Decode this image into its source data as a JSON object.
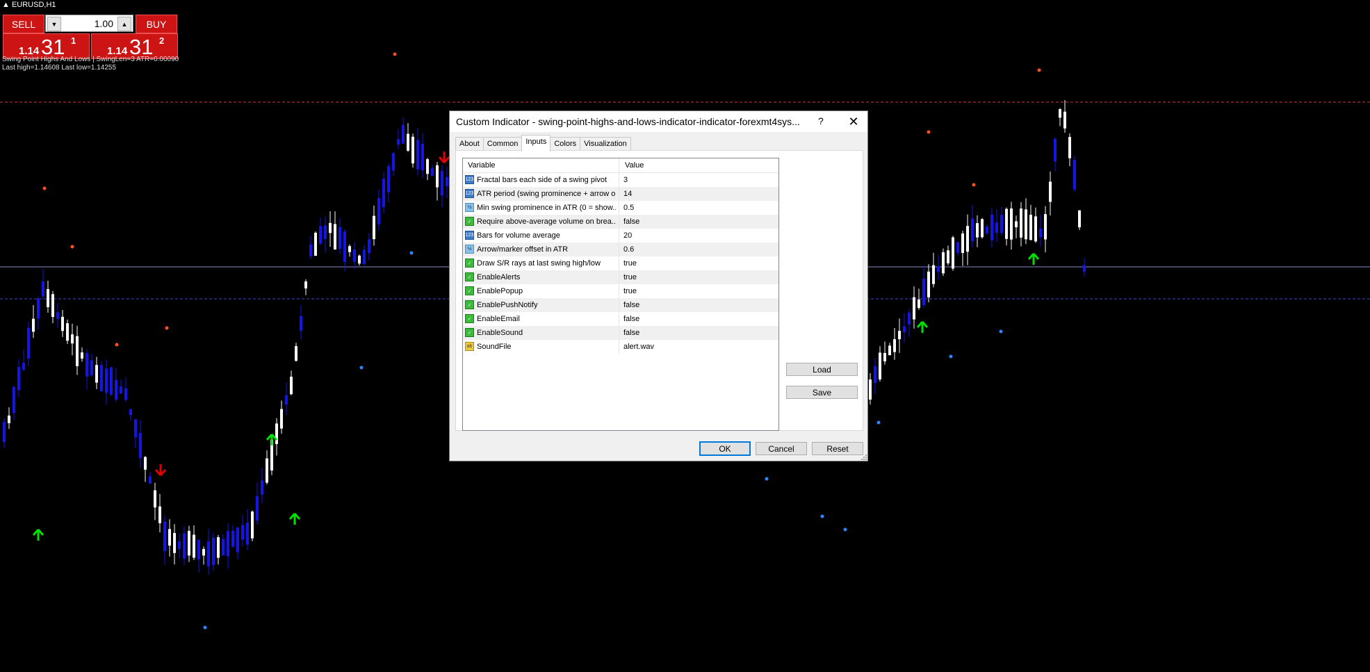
{
  "chart": {
    "symbol_title": "EURUSD,H1",
    "indicator_line1": "Swing Point Highs And Lows | SwingLen=3 ATR=0.00090",
    "indicator_line2": "Last high=1.14608  Last low=1.14255",
    "colors": {
      "background": "#000000",
      "bull_candle": "#ffffff",
      "bear_candle": "#1515e8",
      "up_arrow": "#00e000",
      "down_arrow": "#e00000",
      "high_dot": "#ff5020",
      "low_dot": "#2e86ff",
      "resistance_line": "#d83a3a",
      "support_line": "#3a46d8",
      "current_price_line": "#8a8ad0"
    }
  },
  "trade_panel": {
    "sell_label": "SELL",
    "buy_label": "BUY",
    "lot_value": "1.00",
    "sell_price": {
      "small": "1.14",
      "big": "31",
      "sup": "1"
    },
    "buy_price": {
      "small": "1.14",
      "big": "31",
      "sup": "2"
    }
  },
  "dialog": {
    "title": "Custom Indicator - swing-point-highs-and-lows-indicator-indicator-forexmt4sys...",
    "help_label": "?",
    "close_label": "✕",
    "tabs": [
      "About",
      "Common",
      "Inputs",
      "Colors",
      "Visualization"
    ],
    "active_tab": "Inputs",
    "columns": {
      "variable": "Variable",
      "value": "Value"
    },
    "rows": [
      {
        "icon": "int",
        "icon_text": "123",
        "label": "Fractal bars each side of a swing pivot",
        "value": "3"
      },
      {
        "icon": "int",
        "icon_text": "123",
        "label": "ATR period (swing prominence + arrow o...",
        "value": "14"
      },
      {
        "icon": "dbl",
        "icon_text": "½",
        "label": "Min swing prominence in ATR (0 = show...",
        "value": "0.5"
      },
      {
        "icon": "bool",
        "icon_text": "✓",
        "label": "Require above-average volume on brea...",
        "value": "false"
      },
      {
        "icon": "int",
        "icon_text": "123",
        "label": "Bars for volume average",
        "value": "20"
      },
      {
        "icon": "dbl",
        "icon_text": "½",
        "label": "Arrow/marker offset in ATR",
        "value": "0.6"
      },
      {
        "icon": "bool",
        "icon_text": "✓",
        "label": "Draw S/R rays at last swing high/low",
        "value": "true"
      },
      {
        "icon": "bool",
        "icon_text": "✓",
        "label": "EnableAlerts",
        "value": "true"
      },
      {
        "icon": "bool",
        "icon_text": "✓",
        "label": "EnablePopup",
        "value": "true"
      },
      {
        "icon": "bool",
        "icon_text": "✓",
        "label": "EnablePushNotify",
        "value": "false"
      },
      {
        "icon": "bool",
        "icon_text": "✓",
        "label": "EnableEmail",
        "value": "false"
      },
      {
        "icon": "bool",
        "icon_text": "✓",
        "label": "EnableSound",
        "value": "false"
      },
      {
        "icon": "str",
        "icon_text": "ab",
        "label": "SoundFile",
        "value": "alert.wav"
      }
    ],
    "buttons": {
      "load": "Load",
      "save": "Save",
      "ok": "OK",
      "cancel": "Cancel",
      "reset": "Reset"
    }
  }
}
